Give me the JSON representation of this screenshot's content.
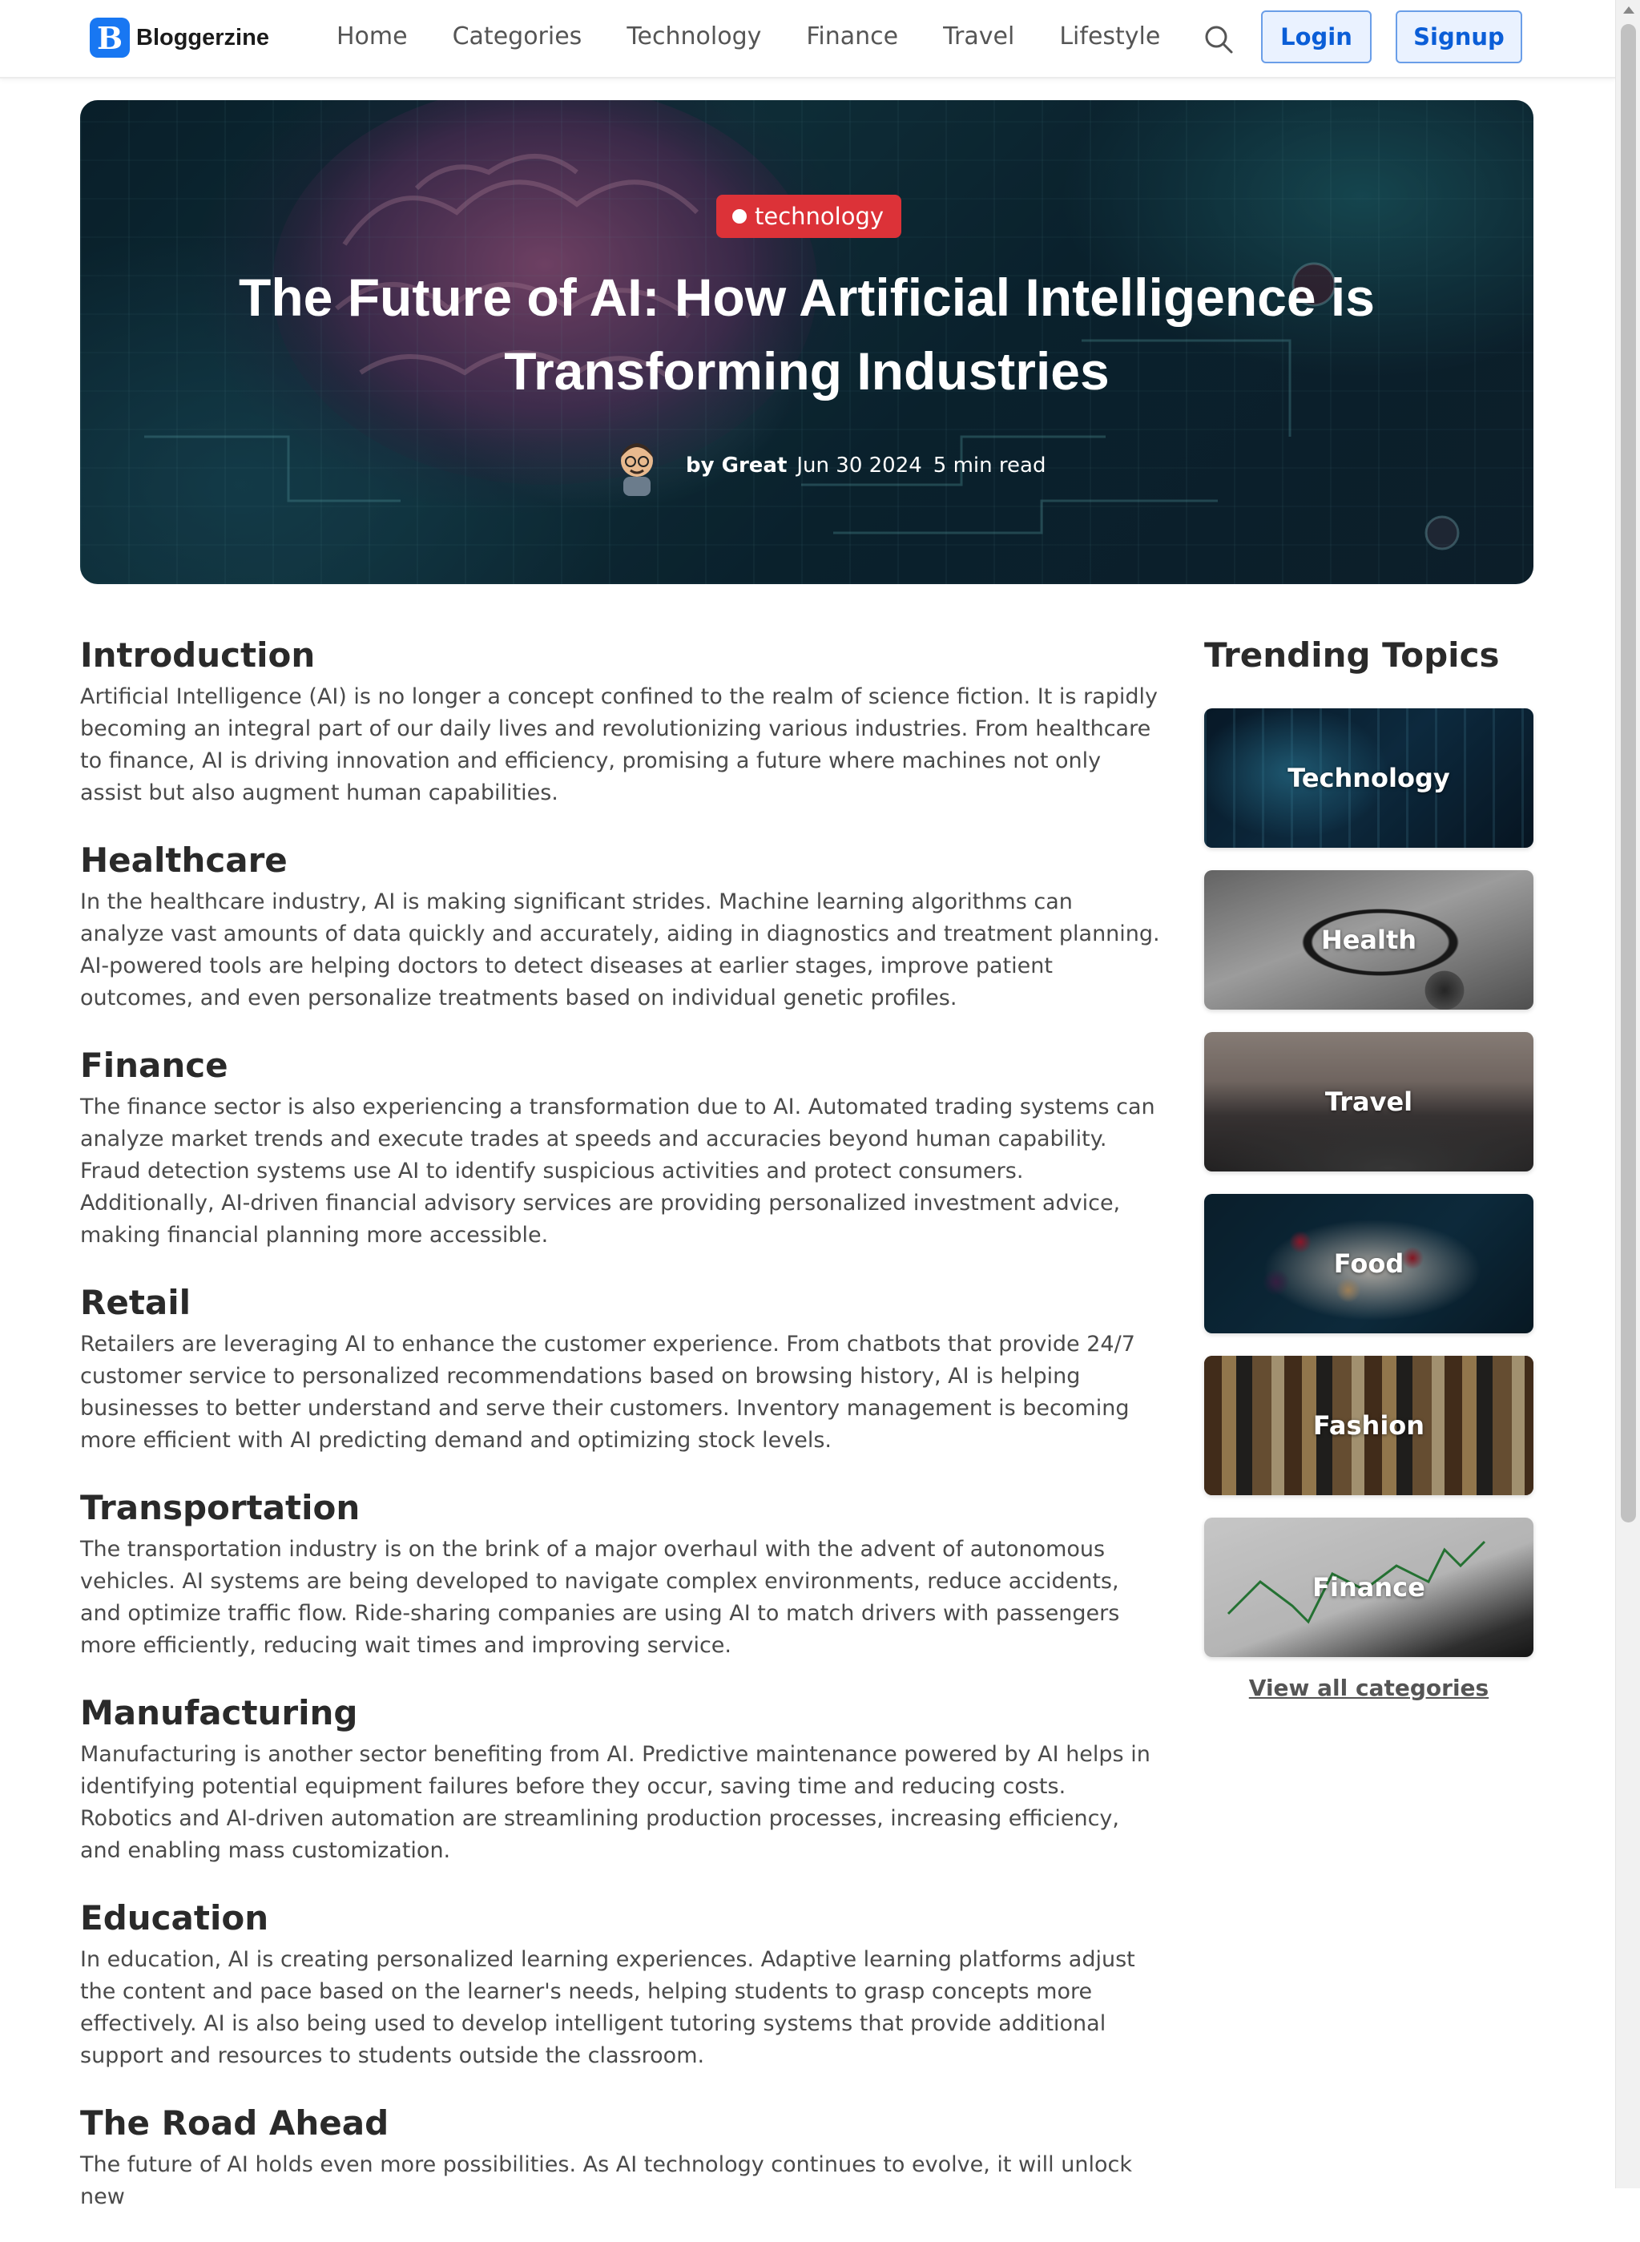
{
  "brand": {
    "logo_letter": "B",
    "name": "Bloggerzine",
    "accent": "#1877f2"
  },
  "nav": {
    "links": [
      "Home",
      "Categories",
      "Technology",
      "Finance",
      "Travel",
      "Lifestyle"
    ],
    "search_icon": "search-icon",
    "login_label": "Login",
    "signup_label": "Signup"
  },
  "hero": {
    "badge": "technology",
    "badge_color": "#dc3238",
    "title": "The Future of AI: How Artificial Intelligence is Transforming Industries",
    "author": "by Great",
    "date": "Jun 30 2024",
    "read_time": "5 min read"
  },
  "article": {
    "sections": [
      {
        "heading": "Introduction",
        "body": "Artificial Intelligence (AI) is no longer a concept confined to the realm of science fiction. It is rapidly becoming an integral part of our daily lives and revolutionizing various industries. From healthcare to finance, AI is driving innovation and efficiency, promising a future where machines not only assist but also augment human capabilities."
      },
      {
        "heading": "Healthcare",
        "body": "In the healthcare industry, AI is making significant strides. Machine learning algorithms can analyze vast amounts of data quickly and accurately, aiding in diagnostics and treatment planning. AI-powered tools are helping doctors to detect diseases at earlier stages, improve patient outcomes, and even personalize treatments based on individual genetic profiles."
      },
      {
        "heading": "Finance",
        "body": "The finance sector is also experiencing a transformation due to AI. Automated trading systems can analyze market trends and execute trades at speeds and accuracies beyond human capability. Fraud detection systems use AI to identify suspicious activities and protect consumers. Additionally, AI-driven financial advisory services are providing personalized investment advice, making financial planning more accessible."
      },
      {
        "heading": "Retail",
        "body": "Retailers are leveraging AI to enhance the customer experience. From chatbots that provide 24/7 customer service to personalized recommendations based on browsing history, AI is helping businesses to better understand and serve their customers. Inventory management is becoming more efficient with AI predicting demand and optimizing stock levels."
      },
      {
        "heading": "Transportation",
        "body": "The transportation industry is on the brink of a major overhaul with the advent of autonomous vehicles. AI systems are being developed to navigate complex environments, reduce accidents, and optimize traffic flow. Ride-sharing companies are using AI to match drivers with passengers more efficiently, reducing wait times and improving service."
      },
      {
        "heading": "Manufacturing",
        "body": "Manufacturing is another sector benefiting from AI. Predictive maintenance powered by AI helps in identifying potential equipment failures before they occur, saving time and reducing costs. Robotics and AI-driven automation are streamlining production processes, increasing efficiency, and enabling mass customization."
      },
      {
        "heading": "Education",
        "body": "In education, AI is creating personalized learning experiences. Adaptive learning platforms adjust the content and pace based on the learner's needs, helping students to grasp concepts more effectively. AI is also being used to develop intelligent tutoring systems that provide additional support and resources to students outside the classroom."
      },
      {
        "heading": "The Road Ahead",
        "body": "The future of AI holds even more possibilities. As AI technology continues to evolve, it will unlock new"
      }
    ]
  },
  "sidebar": {
    "title": "Trending Topics",
    "topics": [
      "Technology",
      "Health",
      "Travel",
      "Food",
      "Fashion",
      "Finance"
    ],
    "view_all": "View all categories"
  }
}
